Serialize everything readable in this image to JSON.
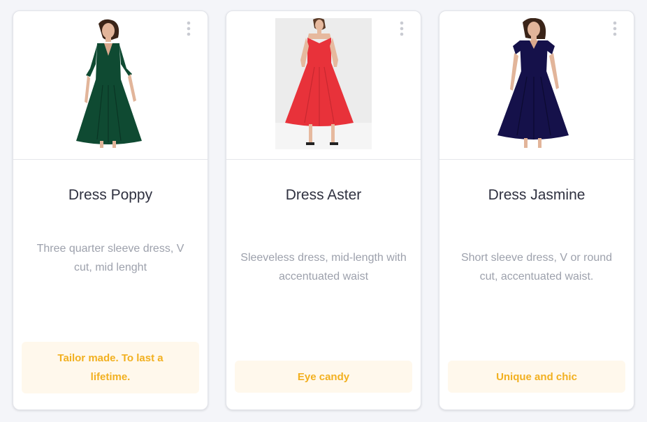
{
  "colors": {
    "background": "#f4f5f9",
    "card": "#ffffff",
    "title_text": "#2f3140",
    "description_text": "#9da1ac",
    "tag_text": "#f2b020",
    "tag_background": "#fff8ec"
  },
  "products": [
    {
      "title": "Dress Poppy",
      "description": "Three quarter sleeve dress, V cut, mid lenght",
      "tag": "Tailor made. To last a lifetime.",
      "dress_color": "#0f4a32",
      "menu_icon": "vertical-ellipsis-icon"
    },
    {
      "title": "Dress Aster",
      "description": "Sleeveless dress, mid-length with accentuated waist",
      "tag": "Eye candy",
      "dress_color": "#e8323a",
      "menu_icon": "vertical-ellipsis-icon"
    },
    {
      "title": "Dress Jasmine",
      "description": "Short sleeve dress, V or round cut, accentuated waist.",
      "tag": "Unique and chic",
      "dress_color": "#15114a",
      "menu_icon": "vertical-ellipsis-icon"
    }
  ]
}
